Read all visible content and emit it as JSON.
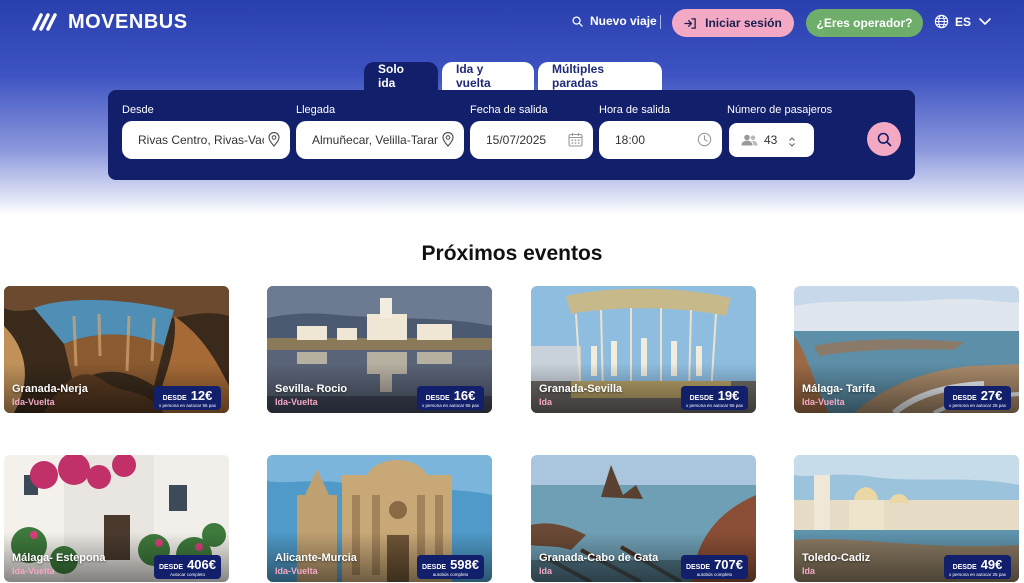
{
  "brand": {
    "name": "MOVENBUS"
  },
  "nav": {
    "new_trip": "Nuevo viaje",
    "login": "Iniciar sesión",
    "operator": "¿Eres operador?",
    "language": "ES"
  },
  "tabs": [
    {
      "label": "Solo ida",
      "active": true
    },
    {
      "label": "Ida y vuelta",
      "active": false
    },
    {
      "label": "Múltiples paradas",
      "active": false
    }
  ],
  "search": {
    "from_label": "Desde",
    "from_value": "Rivas Centro, Rivas-Vaciamadrid",
    "to_label": "Llegada",
    "to_value": "Almuñecar, Velilla-Taramay",
    "date_label": "Fecha de salida",
    "date_value": "15/07/2025",
    "time_label": "Hora de salida",
    "time_value": "18:00",
    "pax_label": "Número de pasajeros",
    "pax_value": "43"
  },
  "events": {
    "title": "Próximos eventos",
    "cards": [
      {
        "name": "Granada-Nerja",
        "type": "Ida-Vuelta",
        "desde": "DESDE",
        "price": "12€",
        "note": "x persona en autocar 55 pax"
      },
      {
        "name": "Sevilla- Rocio",
        "type": "Ida-Vuelta",
        "desde": "DESDE",
        "price": "16€",
        "note": "x persona en autocar 55 pax"
      },
      {
        "name": "Granada-Sevilla",
        "type": "Ida",
        "desde": "DESDE",
        "price": "19€",
        "note": "x persona en autocar 55 pax"
      },
      {
        "name": "Málaga- Tarifa",
        "type": "Ida-Vuelta",
        "desde": "DESDE",
        "price": "27€",
        "note": "x persona en autocar 25 pax"
      },
      {
        "name": "Málaga- Estepona",
        "type": "Ida-Vuelta",
        "desde": "DESDE",
        "price": "406€",
        "note": "Autocar completo"
      },
      {
        "name": "Alicante-Murcia",
        "type": "Ida-Vuelta",
        "desde": "DESDE",
        "price": "598€",
        "note": "autobús completo"
      },
      {
        "name": "Granada-Cabo de Gata",
        "type": "Ida",
        "desde": "DESDE",
        "price": "707€",
        "note": "autobús completo"
      },
      {
        "name": "Toledo-Cadiz",
        "type": "Ida",
        "desde": "DESDE",
        "price": "49€",
        "note": "x persona en autocar 25 pax"
      }
    ]
  },
  "colors": {
    "navy": "#121f6b",
    "pink": "#f3a9c4",
    "green": "#6fae6a",
    "hero_blue": "#2a3fae"
  }
}
